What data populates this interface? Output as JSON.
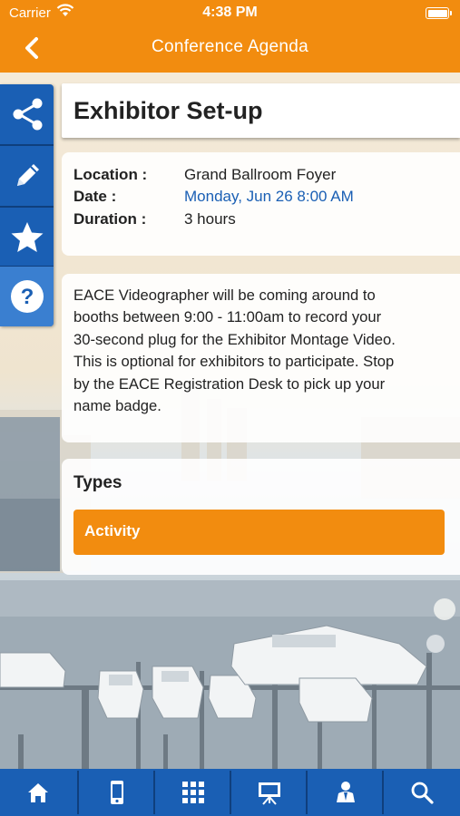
{
  "status_bar": {
    "carrier": "Carrier",
    "time": "4:38 PM"
  },
  "nav": {
    "title": "Conference Agenda"
  },
  "rail": {
    "items": [
      "share-icon",
      "pencil-icon",
      "star-icon",
      "help-icon"
    ]
  },
  "session": {
    "title": "Exhibitor Set-up",
    "location_label": "Location :",
    "location": "Grand Ballroom Foyer",
    "date_label": "Date :",
    "date": "Monday, Jun 26 8:00 AM",
    "duration_label": "Duration :",
    "duration": "3 hours",
    "description_lines": [
      "EACE Videographer will be coming around to",
      "booths between 9:00 - 11:00am to record your",
      "30-second plug for the Exhibitor Montage Video.",
      "This is optional for exhibitors to participate. Stop",
      "by the EACE Registration Desk to pick up your",
      "name badge."
    ]
  },
  "types": {
    "heading": "Types",
    "items": [
      "Activity"
    ]
  },
  "tabbar": {
    "items": [
      "home-icon",
      "mobile-icon",
      "grid-icon",
      "presentation-icon",
      "speaker-icon",
      "search-icon"
    ]
  },
  "colors": {
    "accent": "#f28c0f",
    "primary": "#1a5fb4",
    "link": "#1a5fb4"
  }
}
